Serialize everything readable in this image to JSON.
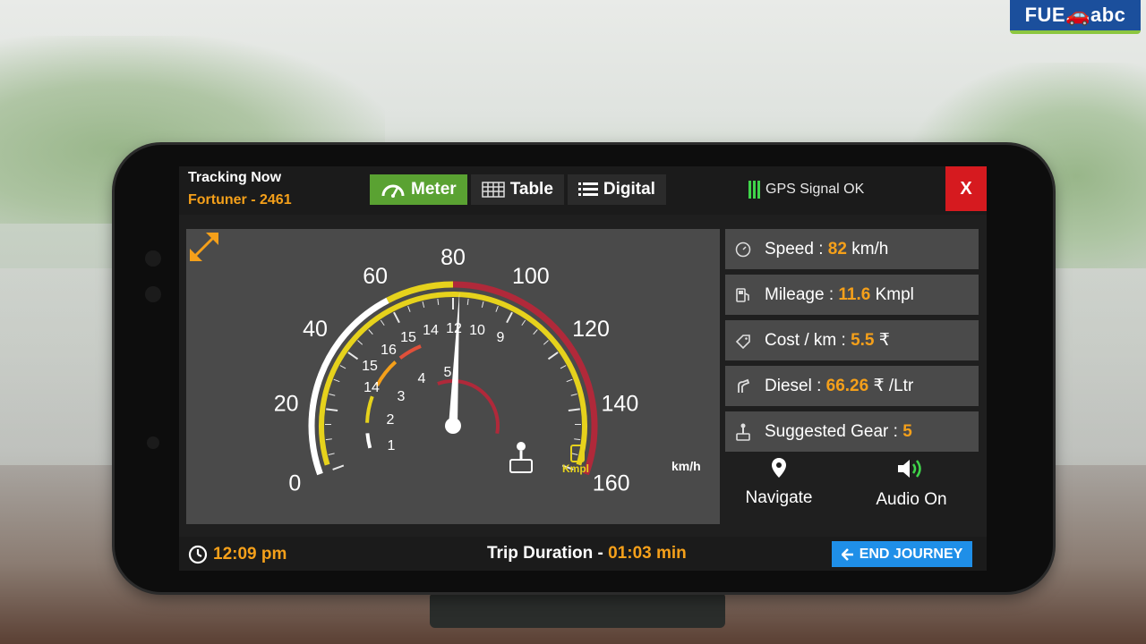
{
  "brand": {
    "name_part1": "FUE",
    "name_part2": "abc"
  },
  "header": {
    "tracking_label": "Tracking Now",
    "vehicle_label": "Fortuner - 2461",
    "tabs": [
      {
        "label": "Meter",
        "icon": "speedometer-icon",
        "active": true
      },
      {
        "label": "Table",
        "icon": "table-icon",
        "active": false
      },
      {
        "label": "Digital",
        "icon": "list-icon",
        "active": false
      }
    ],
    "gps_status": "GPS Signal OK",
    "close_label": "X"
  },
  "meter": {
    "speed_ticks": [
      "0",
      "20",
      "40",
      "60",
      "80",
      "100",
      "120",
      "140",
      "160"
    ],
    "speed_unit": "km/h",
    "current_speed": 82,
    "speed_max": 160,
    "mileage_ticks": [
      "1",
      "2",
      "3",
      "4",
      "5",
      "16",
      "15",
      "14",
      "15",
      "16",
      "14",
      "12",
      "10",
      "9"
    ],
    "mileage_unit": "Kmpl",
    "colors": {
      "accent": "#f5a01a",
      "arc_white": "#ffffff",
      "arc_yellow": "#e6d21c",
      "arc_red": "#b0293a",
      "panel": "#4a4a4a"
    }
  },
  "stats": [
    {
      "icon": "speed-icon",
      "label": "Speed : ",
      "value": "82",
      "unit": " km/h"
    },
    {
      "icon": "fuel-pump-icon",
      "label": "Mileage : ",
      "value": "11.6",
      "unit": " Kmpl"
    },
    {
      "icon": "cost-tag-icon",
      "label": "Cost / km : ",
      "value": "5.5",
      "unit": " ₹"
    },
    {
      "icon": "fuel-nozzle-icon",
      "label": "Diesel : ",
      "value": "66.26",
      "unit": " ₹ /Ltr"
    },
    {
      "icon": "gear-shift-icon",
      "label": "Suggested Gear : ",
      "value": "5",
      "unit": ""
    }
  ],
  "actions": {
    "navigate_label": "Navigate",
    "audio_label": "Audio On"
  },
  "footer": {
    "time": "12:09 pm",
    "trip_label": "Trip Duration - ",
    "trip_value": "01:03 min",
    "end_label": "END JOURNEY"
  }
}
